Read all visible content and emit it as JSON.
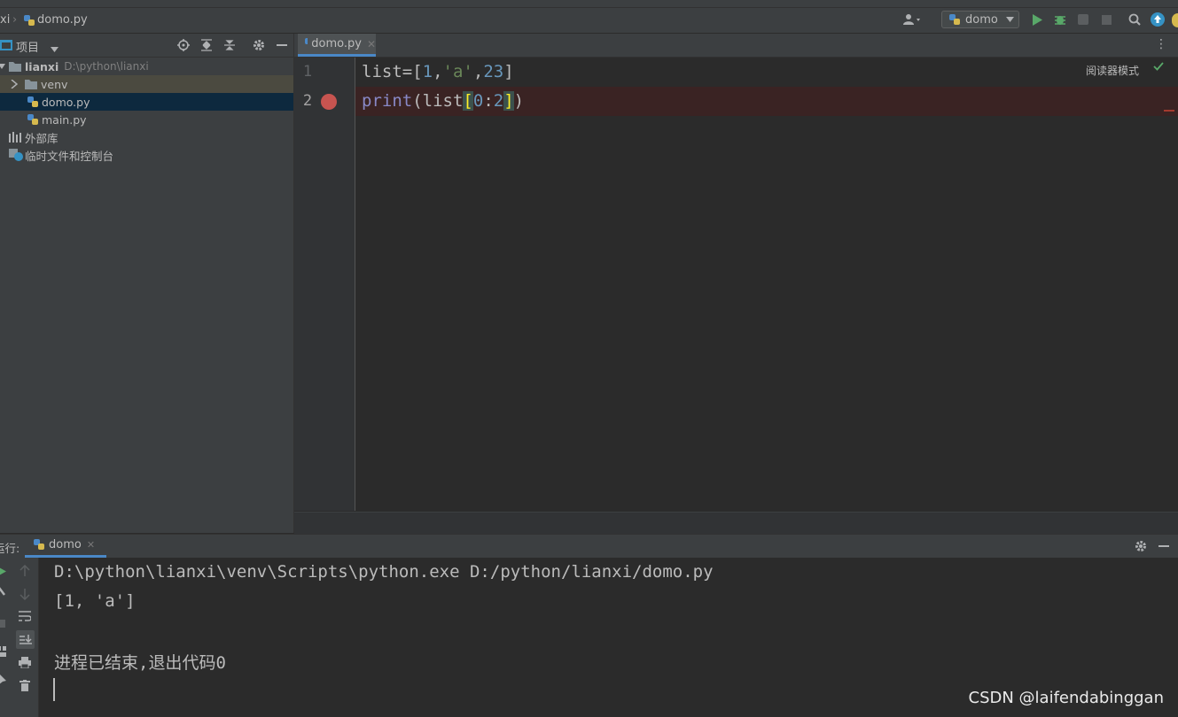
{
  "navbar": {
    "project_crumb": "xi",
    "file_crumb": "domo.py",
    "run_config": "domo"
  },
  "project": {
    "header_label": "项目",
    "root_name": "lianxi",
    "root_path": "D:\\python\\lianxi",
    "items": [
      {
        "label": "venv"
      },
      {
        "label": "domo.py"
      },
      {
        "label": "main.py"
      },
      {
        "label": "外部库"
      },
      {
        "label": "临时文件和控制台"
      }
    ]
  },
  "editor": {
    "tab_label": "domo.py",
    "reader_mode": "阅读器模式",
    "line_numbers": [
      "1",
      "2"
    ],
    "line1": {
      "a": "list=[",
      "n1": "1",
      "c1": ",",
      "s": "'a'",
      "c2": ",",
      "n2": "23",
      "e": "]"
    },
    "line2": {
      "fn": "print",
      "p": "(list",
      "lb": "[",
      "n1": "0",
      "c": ":",
      "n2": "2",
      "rb": "]",
      "e": ")"
    }
  },
  "run": {
    "label": "运行:",
    "tab_label": "domo",
    "console_lines": [
      "D:\\python\\lianxi\\venv\\Scripts\\python.exe D:/python/lianxi/domo.py",
      "[1, 'a']",
      "",
      "进程已结束,退出代码0"
    ]
  },
  "watermark": "CSDN @laifendabinggan",
  "colors": {
    "accent": "#4a88c7",
    "breakpoint": "#c75450",
    "run_green": "#59a869",
    "background": "#2b2b2b"
  }
}
